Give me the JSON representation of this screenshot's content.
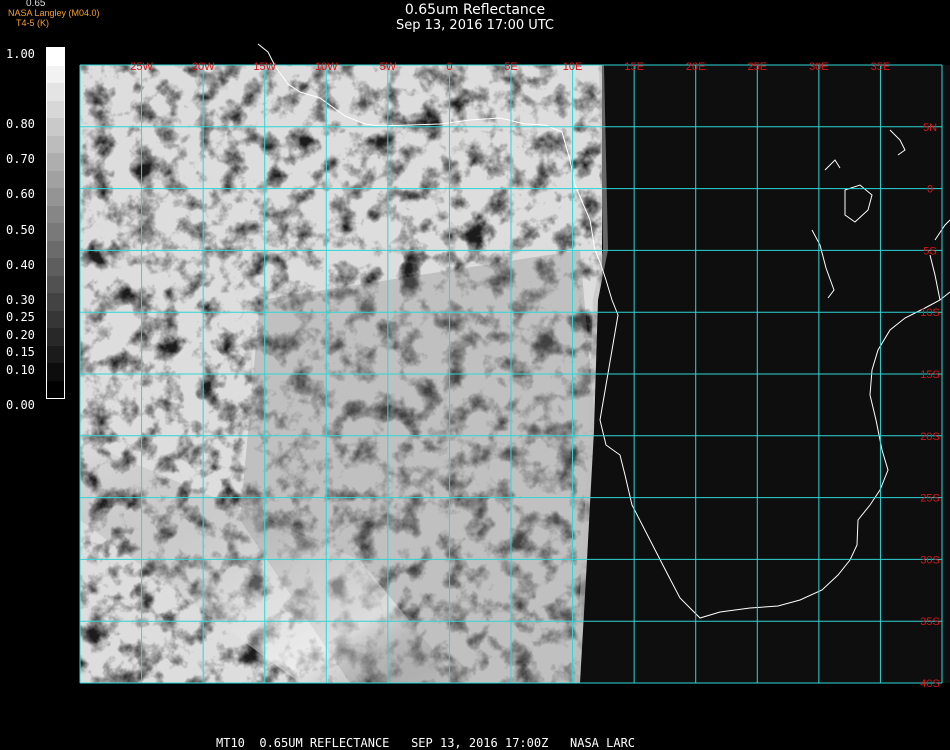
{
  "header": {
    "title": "0.65um Reflectance",
    "subtitle": "Sep 13, 2016 17:00 UTC",
    "org": "NASA Langley (M04.0)",
    "field": "T4-5 (K)",
    "channel": "0.65"
  },
  "colorbar": {
    "labels": [
      "1.00",
      "0.80",
      "0.70",
      "0.60",
      "0.50",
      "0.40",
      "0.30",
      "0.25",
      "0.20",
      "0.15",
      "0.10",
      "0.00"
    ],
    "label_values": [
      1.0,
      0.8,
      0.7,
      0.6,
      0.5,
      0.4,
      0.3,
      0.25,
      0.2,
      0.15,
      0.1,
      0.0
    ]
  },
  "map": {
    "grid_color": "#2fd6d6",
    "label_color": "#d81818",
    "lon_labels": [
      "25W",
      "20W",
      "15W",
      "10W",
      "5W",
      "0",
      "5E",
      "10E",
      "15E",
      "20E",
      "25E",
      "30E",
      "35E"
    ],
    "lon_values": [
      -25,
      -20,
      -15,
      -10,
      -5,
      0,
      5,
      10,
      15,
      20,
      25,
      30,
      35
    ],
    "lat_labels": [
      "5N",
      "0",
      "5S",
      "10S",
      "15S",
      "20S",
      "25S",
      "30S",
      "35S",
      "40S"
    ],
    "lat_values": [
      5,
      0,
      -5,
      -10,
      -15,
      -20,
      -25,
      -30,
      -35,
      -40
    ],
    "top_lat": 10
  },
  "footer": {
    "text": "MT10  0.65UM REFLECTANCE   SEP 13, 2016 17:00Z   NASA LARC"
  }
}
